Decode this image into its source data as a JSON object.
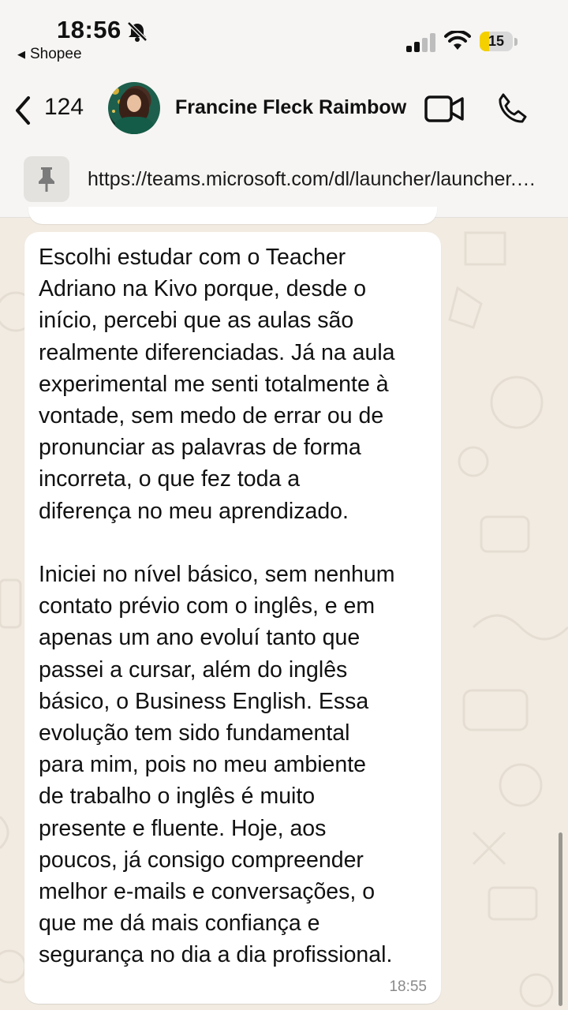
{
  "status_bar": {
    "time": "18:56",
    "back_app": "Shopee",
    "battery": "15",
    "battery_color": "#f5d000"
  },
  "header": {
    "unread_count": "124",
    "contact_name": "Francine Fleck Raimbow",
    "icons": [
      "chevron-left-icon",
      "video-call-icon",
      "phone-call-icon"
    ]
  },
  "pinned": {
    "url": "https://teams.microsoft.com/dl/launcher/launcher.html"
  },
  "message": {
    "paragraph1": "Escolhi estudar com o Teacher\nAdriano na Kivo porque, desde o\ninício, percebi que as aulas são\nrealmente diferenciadas. Já na aula\nexperimental me senti totalmente à\nvontade, sem medo de errar ou de\npronunciar as palavras de forma\nincorreta, o que fez toda a\ndiferença no meu aprendizado.",
    "paragraph2": "Iniciei no nível básico, sem nenhum\ncontato prévio com o inglês, e em\napenas um ano evoluí tanto que\npassei a cursar, além do inglês\nbásico, o Business English. Essa\nevolução tem sido fundamental\npara mim, pois no meu ambiente\nde trabalho o inglês é muito\npresente e fluente. Hoje, aos\npoucos, já consigo compreender\nmelhor e-mails e conversações, o\nque me dá mais confiança e\nsegurança no dia a dia profissional.",
    "time": "18:55"
  }
}
